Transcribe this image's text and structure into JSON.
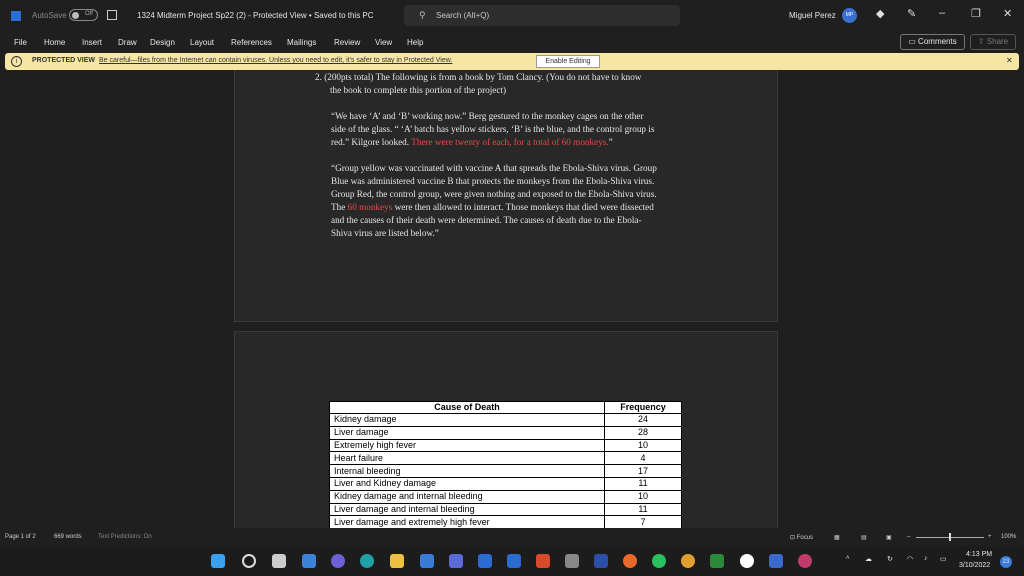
{
  "titlebar": {
    "autosave": "AutoSave",
    "toggle": "Off",
    "title": "1324 Midterm Project Sp22 (2)  -  Protected View • Saved to this PC",
    "search_placeholder": "Search (Alt+Q)",
    "user": "Miguel Perez",
    "avatar": "MP"
  },
  "menu": [
    "File",
    "Home",
    "Insert",
    "Draw",
    "Design",
    "Layout",
    "References",
    "Mailings",
    "Review",
    "View",
    "Help"
  ],
  "comments_label": "Comments",
  "share_label": "Share",
  "protected": {
    "label": "PROTECTED VIEW",
    "message": "Be careful—files from the Internet can contain viruses. Unless you need to edit, it's safer to stay in Protected View.",
    "enable": "Enable Editing"
  },
  "doc": {
    "q_line1": "2.  (200pts total) The following is from a book by Tom Clancy. (You do not have to know",
    "q_line2": "the book to complete this portion of the project)",
    "para1_a": "“We have ‘A’ and ‘B’ working now.” Berg gestured to the monkey cages on the other",
    "para1_b": "side of the glass. “ ‘A’ batch has yellow stickers, ‘B’ is the blue, and the control group is",
    "para1_c": "red.”  Kilgore looked. ",
    "para1_red": "There were twenty of each, for a total of 60 monkeys.",
    "para1_end": "”",
    "para2_a": "“Group yellow was vaccinated with vaccine A that spreads the Ebola-Shiva virus.  Group",
    "para2_b": "Blue was administered vaccine B that protects the monkeys from the Ebola-Shiva virus.",
    "para2_c": "Group Red, the control group, were given nothing and exposed to the Ebola-Shiva virus.",
    "para2_d1": "The ",
    "para2_red": "60 monkeys",
    "para2_d2": " were then allowed to interact.  Those monkeys that died were dissected",
    "para2_e": "and the causes of their death were determined.  The causes of death due to the Ebola-",
    "para2_f": "Shiva virus are listed below.”"
  },
  "table": {
    "headers": [
      "Cause of Death",
      "Frequency"
    ],
    "rows": [
      [
        "Kidney damage",
        "24"
      ],
      [
        "Liver damage",
        "28"
      ],
      [
        "Extremely high fever",
        "10"
      ],
      [
        "Heart failure",
        "4"
      ],
      [
        "Internal bleeding",
        "17"
      ],
      [
        "Liver and Kidney damage",
        "11"
      ],
      [
        "Kidney damage and internal bleeding",
        "10"
      ],
      [
        "Liver damage and internal bleeding",
        "11"
      ],
      [
        "Liver damage and extremely high fever",
        "7"
      ]
    ]
  },
  "status": {
    "page": "Page 1 of 2",
    "words": "669 words",
    "predictions": "Text Predictions: On",
    "focus": "Focus",
    "zoom": "100%"
  },
  "clock": {
    "time": "4:13 PM",
    "date": "3/10/2022",
    "badge": "23"
  }
}
